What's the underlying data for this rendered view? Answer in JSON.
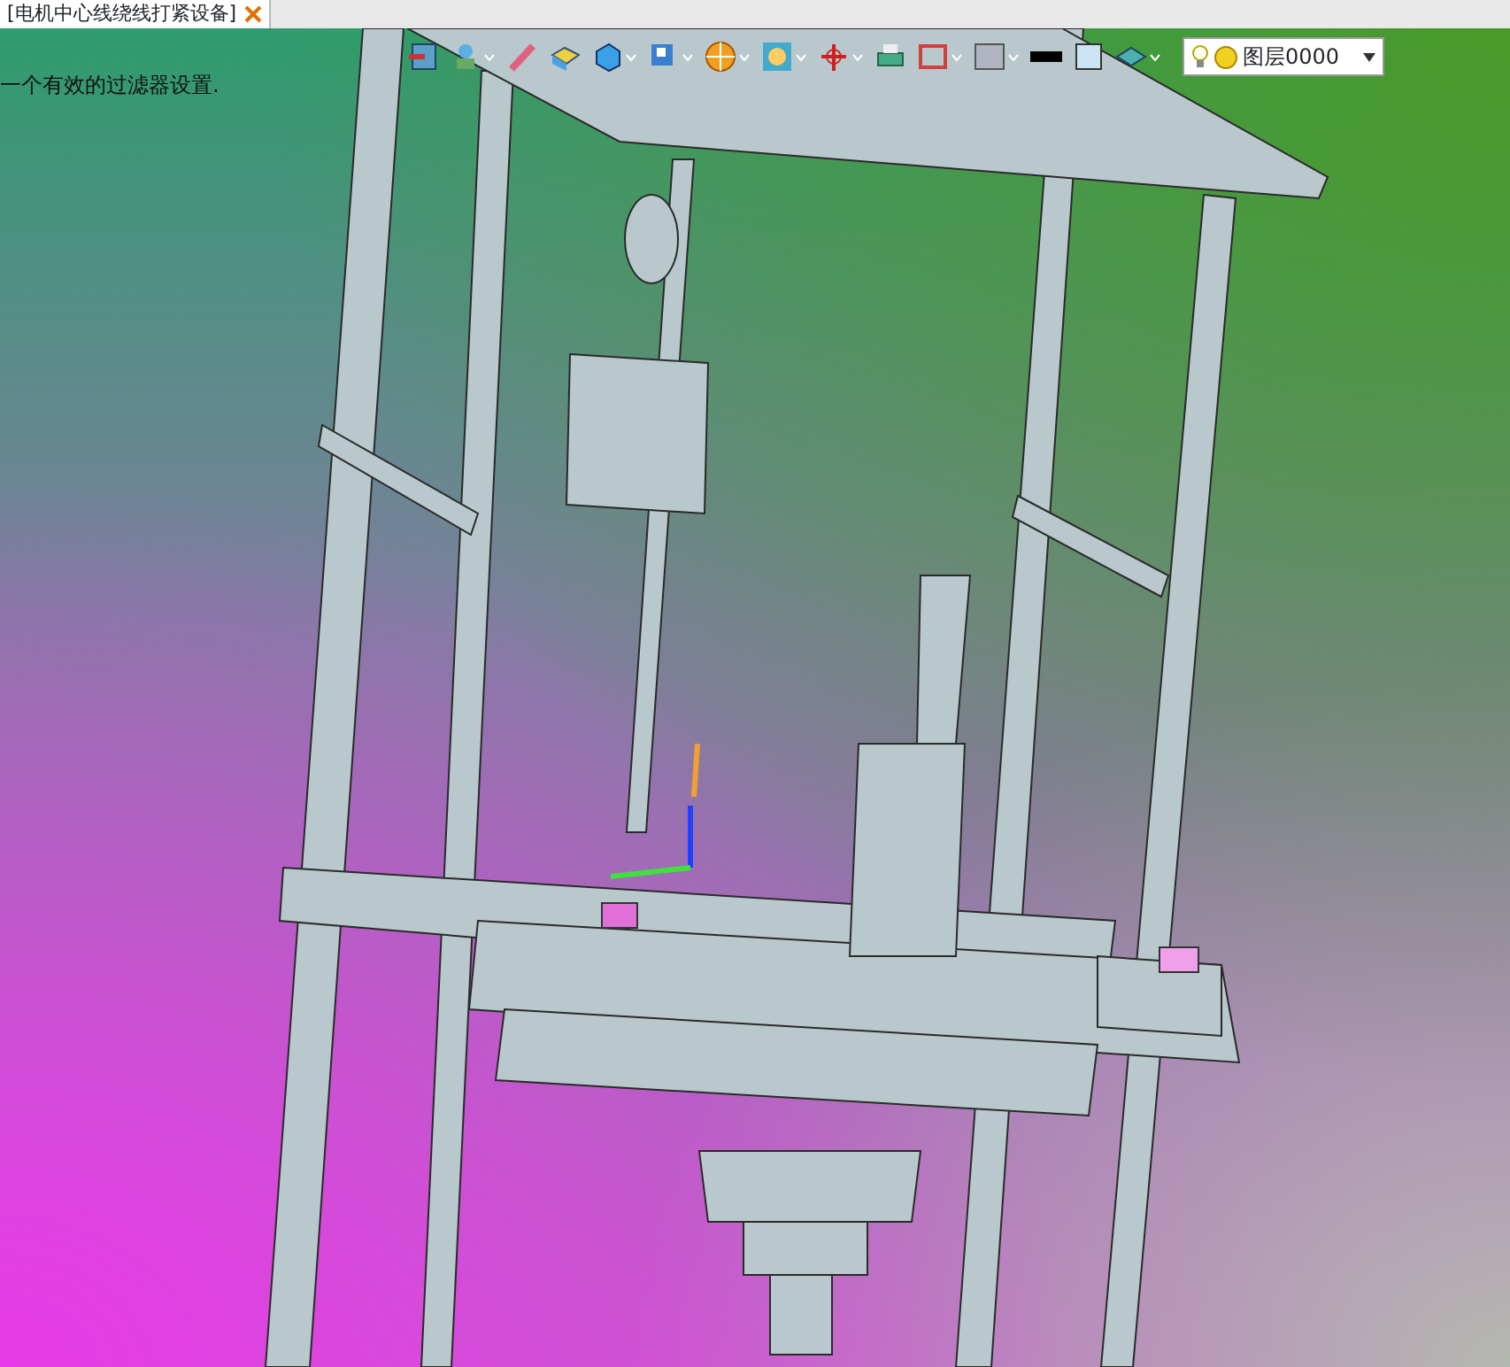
{
  "tabs": [
    {
      "title": "[电机中心线绕线打紧设备]",
      "selected": true
    }
  ],
  "message": "一个有效的过滤器设置.",
  "toolbar": [
    {
      "kind": "exit",
      "menu": false
    },
    {
      "kind": "view",
      "menu": true
    },
    {
      "kind": "pen",
      "menu": false
    },
    {
      "kind": "box",
      "menu": false
    },
    {
      "kind": "cube",
      "menu": true
    },
    {
      "kind": "cubeview",
      "menu": true
    },
    {
      "kind": "wheel",
      "menu": true
    },
    {
      "kind": "zoom",
      "menu": true
    },
    {
      "kind": "axis",
      "menu": true
    },
    {
      "kind": "print",
      "menu": false
    },
    {
      "kind": "frame",
      "menu": true
    },
    {
      "kind": "shade",
      "menu": true
    },
    {
      "kind": "line",
      "menu": false
    },
    {
      "kind": "fill",
      "menu": false
    },
    {
      "kind": "layers",
      "menu": true
    }
  ],
  "layer": {
    "value": "图层0000"
  }
}
